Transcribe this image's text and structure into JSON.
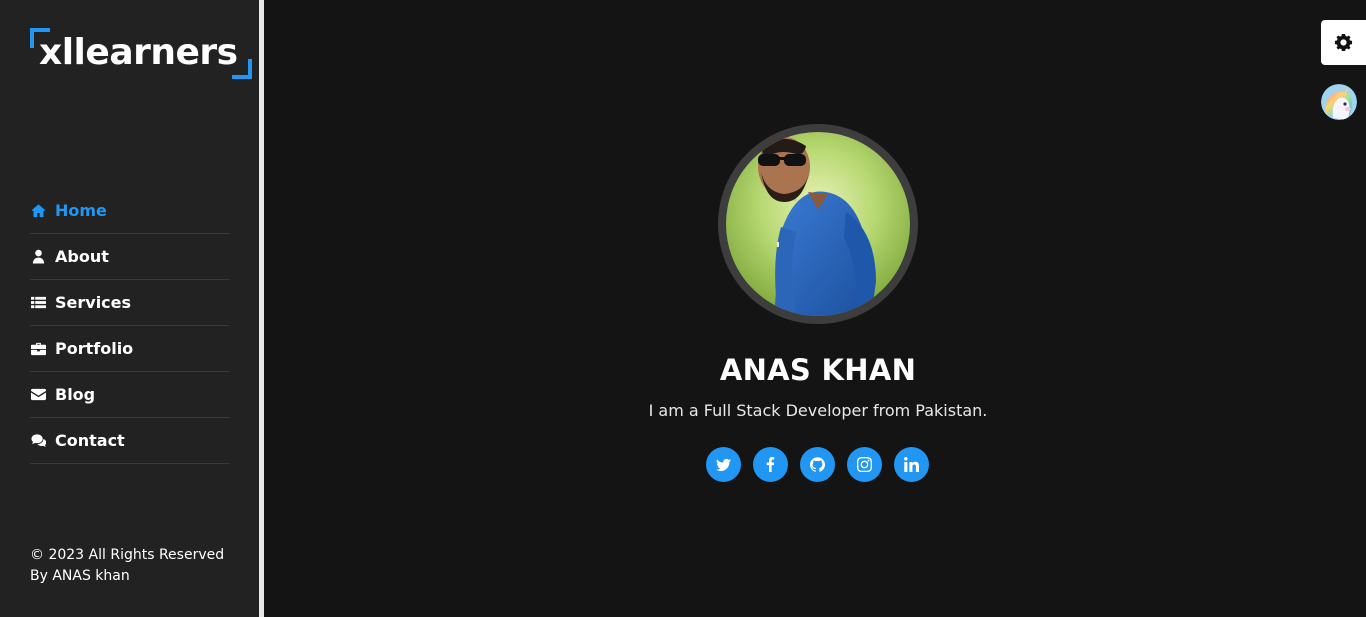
{
  "brand": {
    "logo_text": "xllearners",
    "accent": "#2196f3"
  },
  "sidebar": {
    "items": [
      {
        "label": "Home",
        "icon": "home-icon",
        "active": true
      },
      {
        "label": "About",
        "icon": "user-icon",
        "active": false
      },
      {
        "label": "Services",
        "icon": "list-icon",
        "active": false
      },
      {
        "label": "Portfolio",
        "icon": "briefcase-icon",
        "active": false
      },
      {
        "label": "Blog",
        "icon": "envelope-icon",
        "active": false
      },
      {
        "label": "Contact",
        "icon": "comments-icon",
        "active": false
      }
    ],
    "footer": {
      "line1": "© 2023 All Rights Reserved",
      "line2": "By ANAS khan"
    }
  },
  "hero": {
    "name": "ANAS KHAN",
    "tagline": "I am a Full Stack Developer from Pakistan.",
    "socials": [
      {
        "icon": "twitter-icon"
      },
      {
        "icon": "facebook-icon"
      },
      {
        "icon": "github-icon"
      },
      {
        "icon": "instagram-icon"
      },
      {
        "icon": "linkedin-icon"
      }
    ]
  },
  "floating": {
    "settings_icon": "gear-icon",
    "theme_icon": "unicorn-icon"
  },
  "colors": {
    "background": "#141414",
    "sidebar": "#222222",
    "accent": "#2196f3"
  }
}
